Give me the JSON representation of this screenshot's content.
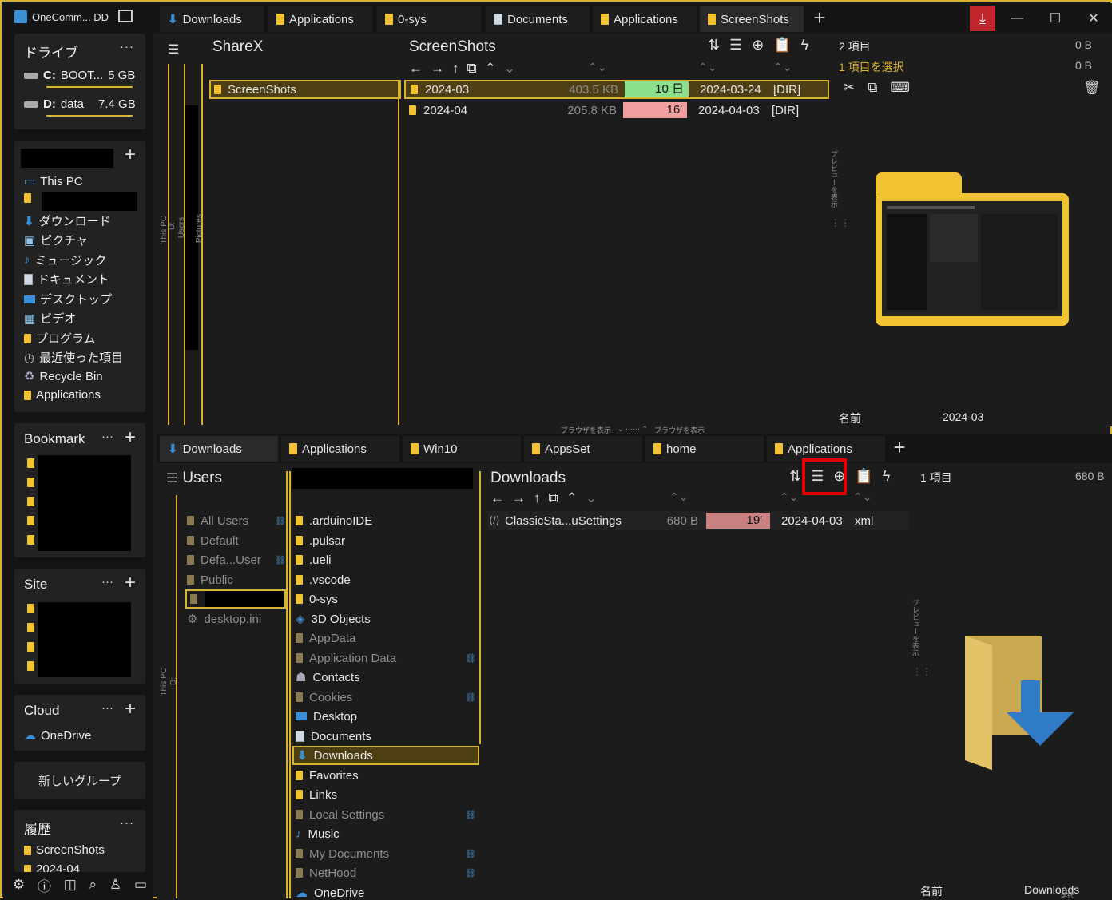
{
  "app": {
    "title": "OneComm... DD"
  },
  "top_tabs": [
    "Downloads",
    "Applications",
    "0-sys",
    "Documents",
    "Applications",
    "ScreenShots"
  ],
  "bottom_tabs": [
    "Downloads",
    "Applications",
    "Win10",
    "AppsSet",
    "home",
    "Applications"
  ],
  "window_controls": {
    "min": "—",
    "max": "☐",
    "close": "✕"
  },
  "drives": {
    "title": "ドライブ",
    "items": [
      {
        "letter": "C:",
        "name": "BOOT...",
        "size": "5 GB"
      },
      {
        "letter": "D:",
        "name": "data",
        "size": "7.4 GB"
      }
    ]
  },
  "places": {
    "items": [
      "This PC",
      "ダウンロード",
      "ピクチャ",
      "ミュージック",
      "ドキュメント",
      "デスクトップ",
      "ビデオ",
      "プログラム",
      "最近使った項目",
      "Recycle Bin",
      "Applications"
    ]
  },
  "bookmark": {
    "title": "Bookmark"
  },
  "site": {
    "title": "Site"
  },
  "cloud": {
    "title": "Cloud",
    "items": [
      "OneDrive"
    ]
  },
  "new_group": "新しいグループ",
  "history": {
    "title": "履歴",
    "items": [
      "ScreenShots",
      "2024-04"
    ]
  },
  "top": {
    "tree_title": "ShareX",
    "tree_items": [
      "ScreenShots"
    ],
    "breadcrumb": [
      "This PC",
      "D:",
      "Users",
      "Pictures"
    ],
    "list_title": "ScreenShots",
    "rows": [
      {
        "name": "2024-03",
        "size": "403.5 KB",
        "age": "10 日",
        "age_color": "#8be08b",
        "date": "2024-03-24",
        "type": "[DIR]"
      },
      {
        "name": "2024-04",
        "size": "205.8 KB",
        "age": "16′",
        "age_color": "#f1a0a0",
        "date": "2024-04-03",
        "type": "[DIR]"
      }
    ],
    "info": {
      "count": "2 項目",
      "count_size": "0 B",
      "selected": "1 項目を選択",
      "selected_size": "0 B"
    },
    "preview_label": "プレビューを表示",
    "name_label": "名前",
    "name_value": "2024-03"
  },
  "splitter": {
    "left": "ブラウザを表示",
    "right": "ブラウザを表示"
  },
  "bottom": {
    "tree_title": "Users",
    "users": [
      "All Users",
      "Default",
      "Defa...User",
      "Public"
    ],
    "users_file": "desktop.ini",
    "breadcrumb": [
      "This PC",
      "D:"
    ],
    "folders": [
      ".arduinoIDE",
      ".pulsar",
      ".ueli",
      ".vscode",
      "0-sys",
      "3D Objects",
      "AppData",
      "Application Data",
      "Contacts",
      "Cookies",
      "Desktop",
      "Documents",
      "Downloads",
      "Favorites",
      "Links",
      "Local Settings",
      "Music",
      "My Documents",
      "NetHood",
      "OneDrive"
    ],
    "list_title": "Downloads",
    "rows": [
      {
        "name": "ClassicSta...uSettings",
        "size": "680 B",
        "age": "19′",
        "age_color": "#c98080",
        "date": "2024-04-03",
        "type": "xml"
      }
    ],
    "info": {
      "count": "1 項目",
      "count_size": "680 B"
    },
    "preview_label": "プレビューを表示",
    "name_label": "名前",
    "name_value": "Downloads",
    "status": "選択"
  },
  "colors": {
    "accent": "#d9b230",
    "folder": "#f1c232",
    "highlight": "#e00000"
  }
}
